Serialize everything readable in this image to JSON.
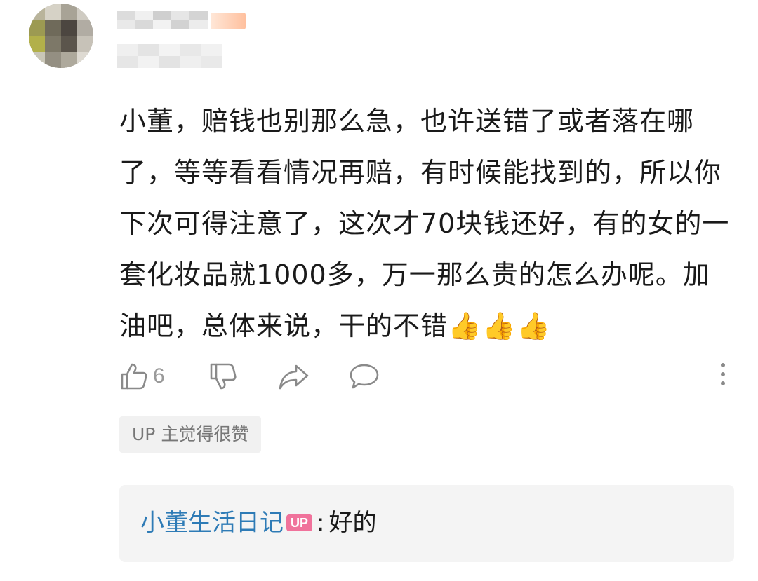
{
  "comment": {
    "text": "小董，赔钱也别那么急，也许送错了或者落在哪了，等等看看情况再赔，有时候能找到的，所以你下次可得注意了，这次才70块钱还好，有的女的一套化妆品就1000多，万一那么贵的怎么办呢。加油吧，总体来说，干的不错",
    "emoji": "👍👍👍"
  },
  "actions": {
    "like_count": "6",
    "icons": [
      "thumb-up-icon",
      "thumb-down-icon",
      "share-icon",
      "reply-icon",
      "more-icon"
    ]
  },
  "up_liked_tag": "UP 主觉得很赞",
  "reply": {
    "author": "小董生活日记",
    "badge": "UP",
    "separator": ":",
    "text": "好的"
  },
  "colors": {
    "reply_author": "#2e7bb6",
    "up_badge": "#f0729b",
    "text": "#1a1a1a",
    "muted": "#9a9a9a"
  }
}
